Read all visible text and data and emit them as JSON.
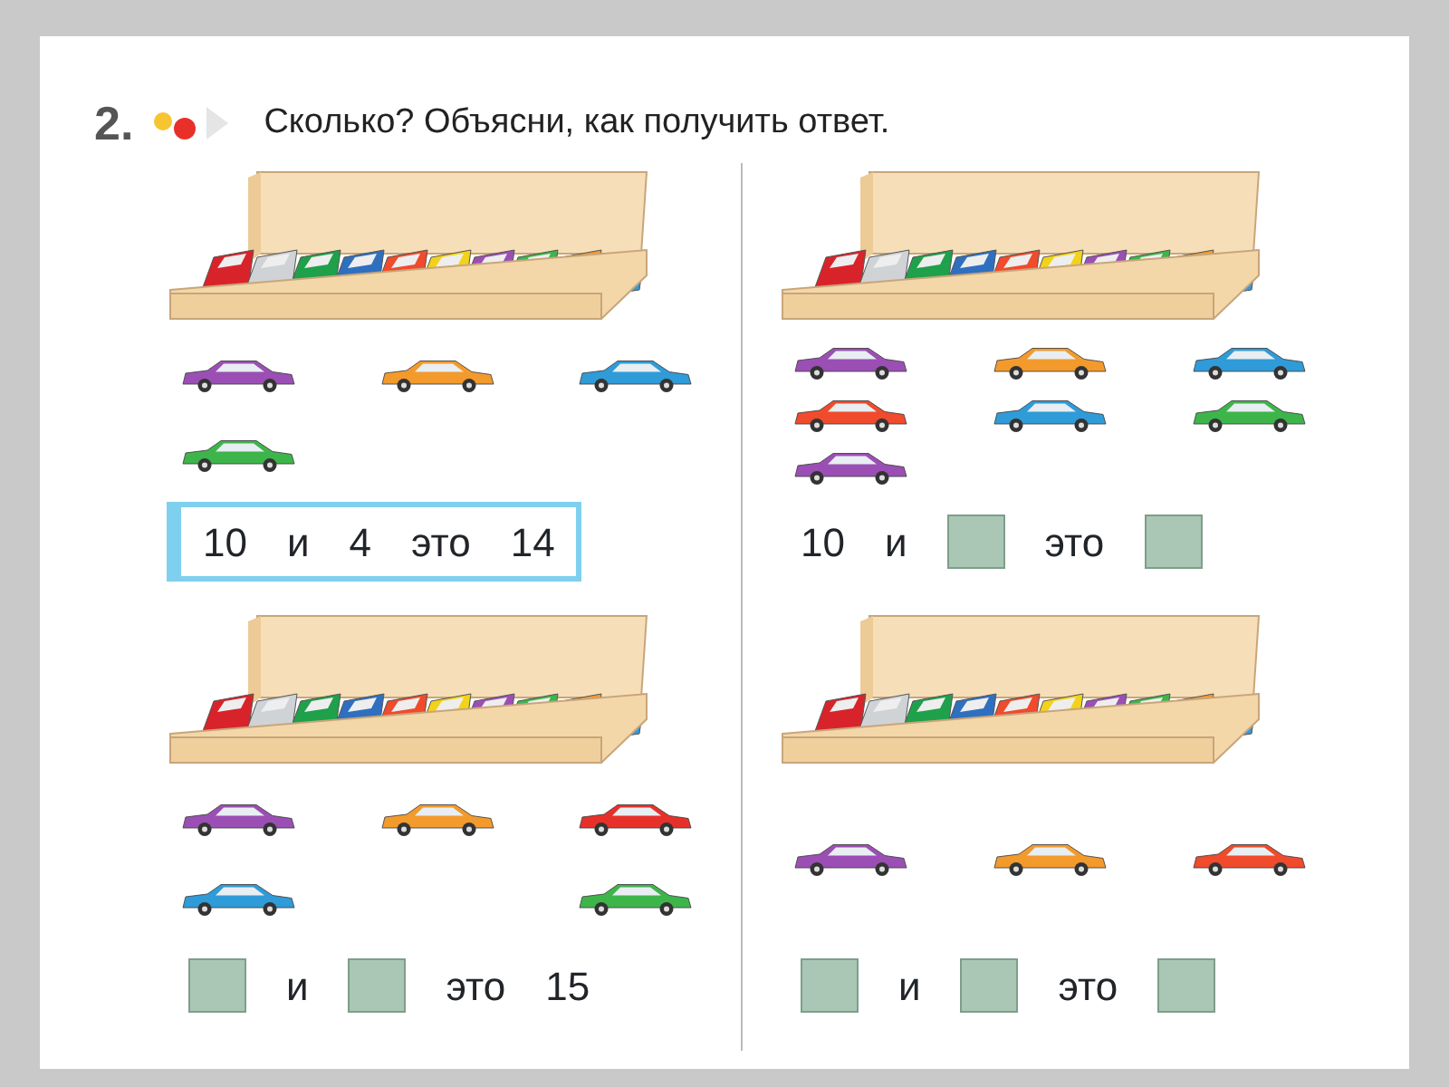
{
  "exercise": {
    "number": "2.",
    "instruction": "Сколько? Объясни, как получить ответ."
  },
  "panels": [
    {
      "loose_cars": [
        {
          "color": "#9b4fb5"
        },
        {
          "color": "#f39a2c"
        },
        {
          "color": "#2f9bd8"
        },
        {
          "color": "#3db54a"
        }
      ],
      "equation": {
        "framed": true,
        "items": [
          {
            "kind": "number",
            "text": "10"
          },
          {
            "kind": "word",
            "text": "и"
          },
          {
            "kind": "number",
            "text": "4"
          },
          {
            "kind": "word",
            "text": "это"
          },
          {
            "kind": "number",
            "text": "14"
          }
        ]
      }
    },
    {
      "loose_cars": [
        {
          "color": "#9b4fb5"
        },
        {
          "color": "#f39a2c"
        },
        {
          "color": "#2f9bd8"
        },
        {
          "color": "#ef4b2c"
        },
        {
          "color": "#2f9bd8"
        },
        {
          "color": "#3db54a"
        },
        {
          "color": "#9b4fb5"
        }
      ],
      "equation": {
        "framed": false,
        "items": [
          {
            "kind": "number",
            "text": "10"
          },
          {
            "kind": "word",
            "text": "и"
          },
          {
            "kind": "blank"
          },
          {
            "kind": "word",
            "text": "это"
          },
          {
            "kind": "blank"
          }
        ]
      }
    },
    {
      "loose_cars": [
        {
          "color": "#9b4fb5"
        },
        {
          "color": "#f39a2c"
        },
        {
          "color": "#e8302a"
        },
        {
          "color": "#2f9bd8"
        },
        {
          "color": "#3db54a"
        }
      ],
      "equation": {
        "framed": false,
        "items": [
          {
            "kind": "blank"
          },
          {
            "kind": "word",
            "text": "и"
          },
          {
            "kind": "blank"
          },
          {
            "kind": "word",
            "text": "это"
          },
          {
            "kind": "number",
            "text": "15"
          }
        ]
      }
    },
    {
      "loose_cars": [
        {
          "color": "#9b4fb5"
        },
        {
          "color": "#f39a2c"
        },
        {
          "color": "#ef4b2c"
        }
      ],
      "equation": {
        "framed": false,
        "items": [
          {
            "kind": "blank"
          },
          {
            "kind": "word",
            "text": "и"
          },
          {
            "kind": "blank"
          },
          {
            "kind": "word",
            "text": "это"
          },
          {
            "kind": "blank"
          }
        ]
      }
    }
  ]
}
